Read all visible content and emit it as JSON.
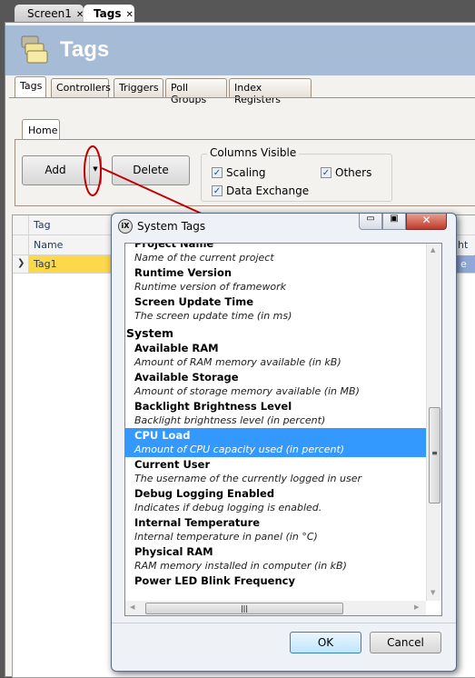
{
  "doc_tabs": [
    {
      "label": "Screen1",
      "active": false
    },
    {
      "label": "Tags",
      "active": true
    }
  ],
  "header": {
    "title": "Tags",
    "icon": "tags-folder-icon",
    "color": "#a6bcd6"
  },
  "page_tabs": [
    "Tags",
    "Controllers",
    "Triggers",
    "Poll Groups",
    "Index Registers"
  ],
  "ribbon": {
    "tab": "Home",
    "add_label": "Add",
    "delete_label": "Delete",
    "columns_visible": {
      "title": "Columns Visible",
      "options": [
        {
          "label": "Scaling",
          "checked": true
        },
        {
          "label": "Others",
          "checked": true
        },
        {
          "label": "Data Exchange",
          "checked": true
        }
      ]
    }
  },
  "grid": {
    "header_row1": "Tag",
    "header_row2": "Name",
    "rows": [
      {
        "name": "Tag1"
      }
    ],
    "partial_right_header": "ght",
    "partial_right_cell": "e",
    "selected_row_color": "#fdd84a"
  },
  "dialog": {
    "title": "System Tags",
    "ok_label": "OK",
    "cancel_label": "Cancel",
    "items": [
      {
        "type": "name",
        "text": "Project Name"
      },
      {
        "type": "desc",
        "text": "Name of the current project"
      },
      {
        "type": "name",
        "text": "Runtime Version"
      },
      {
        "type": "desc",
        "text": "Runtime version of framework"
      },
      {
        "type": "name",
        "text": "Screen Update Time"
      },
      {
        "type": "desc",
        "text": "The screen update time (in ms)"
      },
      {
        "type": "cat",
        "text": "System"
      },
      {
        "type": "name",
        "text": "Available RAM"
      },
      {
        "type": "desc",
        "text": "Amount of RAM memory available (in kB)"
      },
      {
        "type": "name",
        "text": "Available Storage"
      },
      {
        "type": "desc",
        "text": "Amount of storage memory available (in MB)"
      },
      {
        "type": "name",
        "text": "Backlight Brightness Level"
      },
      {
        "type": "desc",
        "text": "Backlight brightness level (in percent)"
      },
      {
        "type": "name",
        "text": "CPU Load",
        "selected": true
      },
      {
        "type": "desc",
        "text": "Amount of CPU capacity used (in percent)",
        "selected": true
      },
      {
        "type": "name",
        "text": "Current User"
      },
      {
        "type": "desc",
        "text": "The username of the currently logged in user"
      },
      {
        "type": "name",
        "text": "Debug Logging Enabled"
      },
      {
        "type": "desc",
        "text": "Indicates if debug logging is enabled."
      },
      {
        "type": "name",
        "text": "Internal Temperature"
      },
      {
        "type": "desc",
        "text": "Internal temperature in panel (in °C)"
      },
      {
        "type": "name",
        "text": "Physical RAM"
      },
      {
        "type": "desc",
        "text": "RAM memory installed in computer (in kB)"
      },
      {
        "type": "name",
        "text": "Power LED Blink Frequency"
      }
    ],
    "selection_color": "#3399ff"
  },
  "annotation": {
    "color": "#c00000"
  }
}
